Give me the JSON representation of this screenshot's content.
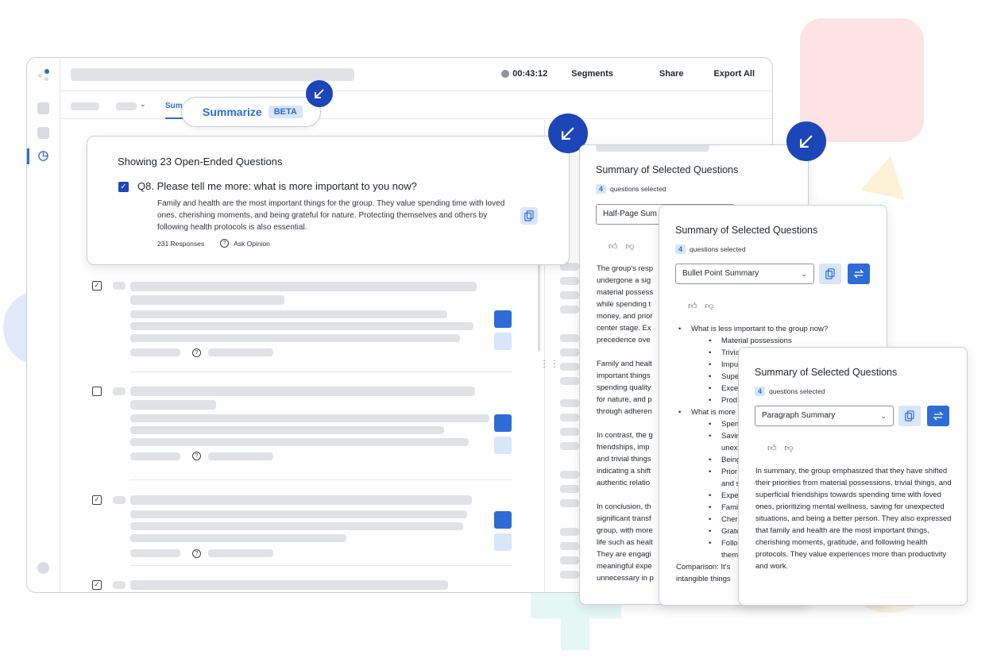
{
  "topbar": {
    "timer": "00:43:12",
    "segments_label": "Segments",
    "share_label": "Share",
    "export_label": "Export All"
  },
  "tabs": {
    "active_partial": "Sum"
  },
  "summarize": {
    "label": "Summarize",
    "badge": "BETA"
  },
  "question_card": {
    "heading": "Showing 23 Open-Ended Questions",
    "question": "Q8.  Please tell me more: what is more important to you now?",
    "answer": "Family and health are the most important things for the group. They value spending time with loved ones, cherishing moments, and being grateful for nature. Protecting themselves and others by following health protocols is also essential.",
    "responses": "231 Responses",
    "ask_opinion": "Ask Opinion"
  },
  "panel_half": {
    "title": "Summary of Selected Questions",
    "count": "4",
    "selected_label": "questions selected",
    "select_value": "Half-Page Sum",
    "paragraphs": [
      [
        "The group's resp",
        "undergone a sig",
        "material possess",
        "while spending t",
        "money, and prior",
        "center stage. Ex",
        "precedence ove"
      ],
      [
        "Family and healt",
        "important things",
        "spending quality",
        "for nature, and p",
        "through adheren"
      ],
      [
        "In contrast, the g",
        "friendships, imp",
        "and trivial things",
        "indicating a shift",
        "authentic relatio"
      ],
      [
        "In conclusion, th",
        "significant transf",
        "group, with more",
        "life such as healt",
        "They are engagi",
        "meaningful expe",
        "unnecessary in p"
      ]
    ]
  },
  "panel_bullet": {
    "title": "Summary of Selected Questions",
    "count": "4",
    "selected_label": "questions selected",
    "select_value": "Bullet Point Summary",
    "heading1": "What is less important to the group now?",
    "items1": [
      "Material possessions",
      "Trivia",
      "Impu",
      "Supe",
      "Exce",
      "Prod"
    ],
    "heading2": "What is more",
    "items2": [
      "Spen",
      "Savin",
      "unex",
      "Being",
      "Prior",
      "and s",
      "Expe",
      "Fami",
      "Cher",
      "Grate",
      "Follo",
      "them"
    ],
    "comparison_1": "Comparison: It's",
    "comparison_2": "intangible things"
  },
  "panel_paragraph": {
    "title": "Summary of Selected Questions",
    "count": "4",
    "selected_label": "questions selected",
    "select_value": "Paragraph Summary",
    "text": "In summary, the group emphasized that they have shifted their priorities from material possessions, trivial things, and superficial friendships towards spending time with loved ones, prioritizing mental wellness, saving for unexpected situations, and being a better person. They also expressed that family and health are the most important things, cherishing moments, gratitude, and following health protocols. They value experiences more than productivity and work."
  },
  "colors": {
    "accent": "#2d6bd6",
    "accent_dark": "#1c45b8",
    "accent_light": "#d8e6fb"
  },
  "icons": [
    "logo-icon",
    "pie-chart-icon",
    "arrow-down-left-icon",
    "copy-icon",
    "regenerate-icon",
    "thumbs-up-icon",
    "thumbs-down-icon",
    "chevron-down-icon",
    "ask-opinion-icon",
    "recording-dot-icon",
    "drag-handle-icon"
  ]
}
